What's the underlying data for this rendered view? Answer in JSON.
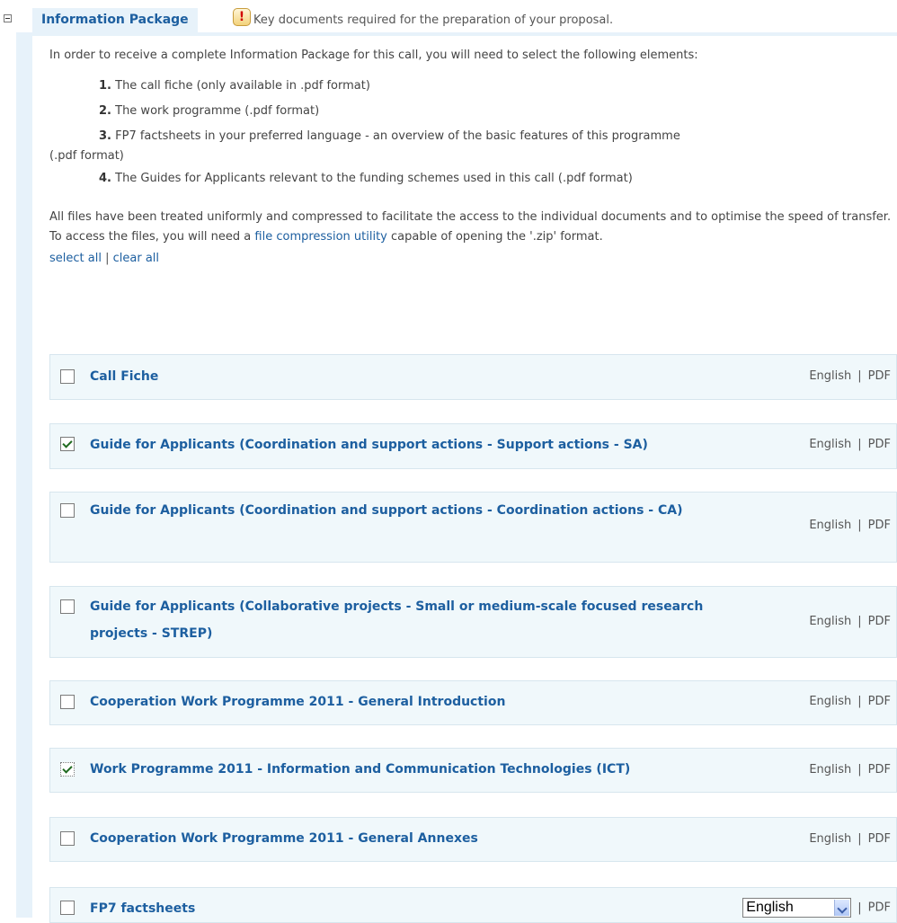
{
  "section": {
    "title": "Information Package",
    "description": "Key documents required for the preparation of your proposal."
  },
  "intro": "In order to receive a complete Information Package for this call, you will need to select the following elements:",
  "steps": [
    {
      "num": "1.",
      "text": "The call fiche (only available in .pdf format)"
    },
    {
      "num": "2.",
      "text": "The work programme (.pdf format)"
    },
    {
      "num": "3.",
      "text": "FP7 factsheets in your preferred language - an overview of the basic features of this programme",
      "cont": "(.pdf format)"
    },
    {
      "num": "4.",
      "text": "The Guides for Applicants relevant to the funding schemes used in this call (.pdf format)"
    }
  ],
  "files_note": {
    "before": "All files have been treated uniformly and compressed to facilitate the access to the individual documents and to optimise the speed of transfer. To access the files, you will need a ",
    "link": "file compression utility",
    "after": " capable of opening the '.zip' format."
  },
  "select_all": "select all",
  "separator": "|",
  "clear_all": "clear all",
  "documents": [
    {
      "title": "Call Fiche",
      "checked": false,
      "language": "English",
      "format": "PDF"
    },
    {
      "title": "Guide for Applicants (Coordination and support actions - Support actions - SA)",
      "checked": true,
      "language": "English",
      "format": "PDF"
    },
    {
      "title": "Guide for Applicants (Coordination and support actions - Coordination actions - CA)",
      "checked": false,
      "language": "English",
      "format": "PDF"
    },
    {
      "title": "Guide for Applicants (Collaborative projects - Small or medium-scale focused research projects - STREP)",
      "checked": false,
      "language": "English",
      "format": "PDF"
    },
    {
      "title": "Cooperation Work Programme 2011 - General Introduction",
      "checked": false,
      "language": "English",
      "format": "PDF"
    },
    {
      "title": "Work Programme 2011 - Information and Communication Technologies (ICT)",
      "checked": true,
      "language": "English",
      "format": "PDF"
    },
    {
      "title": "Cooperation Work Programme 2011 - General Annexes",
      "checked": false,
      "language": "English",
      "format": "PDF"
    },
    {
      "title": "FP7 factsheets",
      "checked": false,
      "language_select": "English",
      "format": "PDF"
    }
  ]
}
